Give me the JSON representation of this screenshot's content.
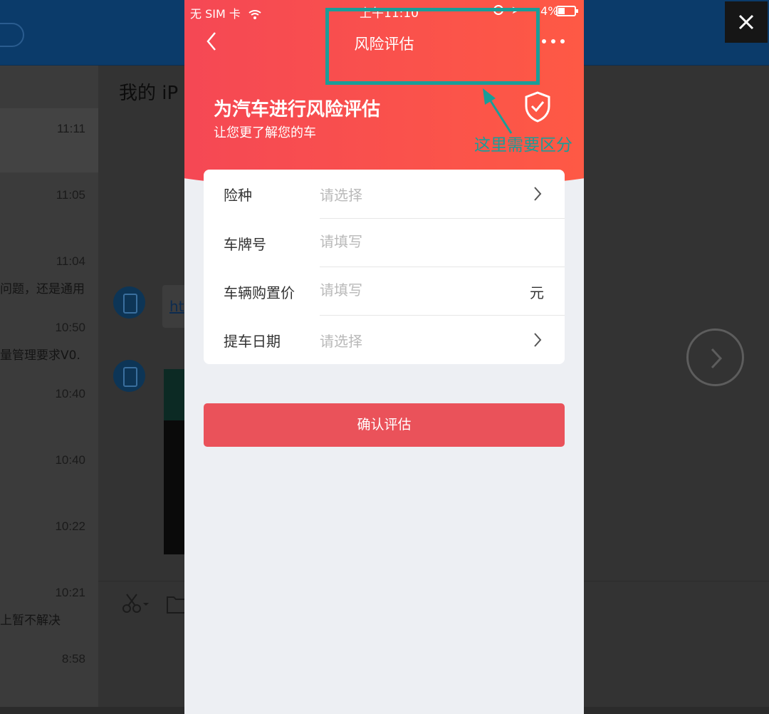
{
  "background": {
    "chat_title": "我的 iP",
    "timestamps": [
      "11:11",
      "11:05",
      "11:04",
      "10:50",
      "10:40",
      "10:40",
      "10:22",
      "10:21",
      "8:58"
    ],
    "messages": [
      "问题，还是通用",
      "量管理要求V0.",
      "上暂不解决"
    ],
    "link_text": "ht"
  },
  "status_bar": {
    "carrier": "无 SIM 卡",
    "time": "上午11:10",
    "battery_pct": "4",
    "battery_suffix": "%"
  },
  "nav": {
    "title": "风险评估",
    "back_icon": "chevron-left-icon",
    "more_icon": "more-dots-icon"
  },
  "hero": {
    "title": "为汽车进行风险评估",
    "subtitle": "让您更了解您的车",
    "icon": "shield-check-icon"
  },
  "form": {
    "rows": [
      {
        "label": "险种",
        "placeholder": "请选择",
        "type": "select"
      },
      {
        "label": "车牌号",
        "placeholder": "请填写",
        "type": "input"
      },
      {
        "label": "车辆购置价",
        "placeholder": "请填写",
        "type": "input",
        "unit": "元"
      },
      {
        "label": "提车日期",
        "placeholder": "请选择",
        "type": "select"
      }
    ]
  },
  "confirm_button": "确认评估",
  "annotation": {
    "text": "这里需要区分",
    "color": "#1a9d98"
  },
  "colors": {
    "gradient_start": "#f44656",
    "gradient_end": "#ff5b43",
    "button": "#ea525a"
  }
}
